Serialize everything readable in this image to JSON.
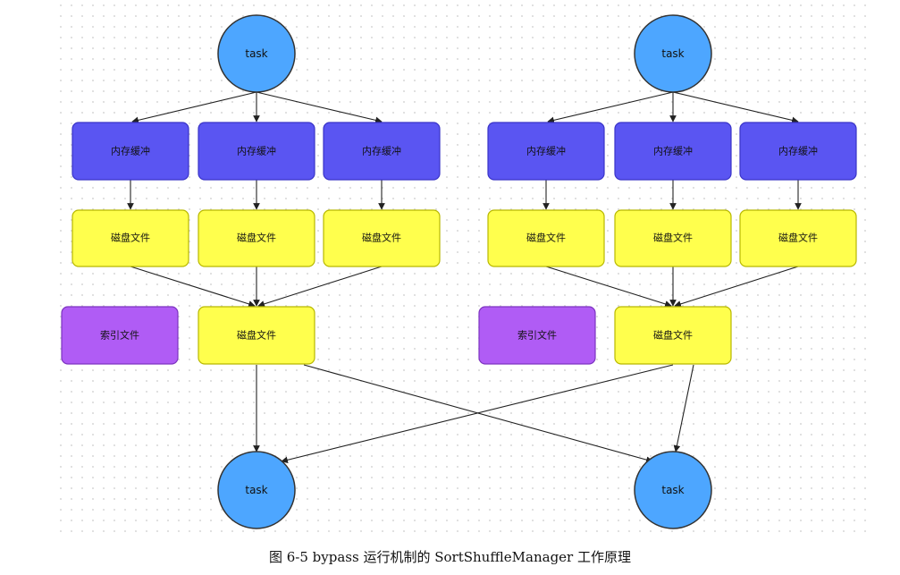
{
  "labels": {
    "task": "task",
    "memory_buffer": "内存缓冲",
    "disk_file": "磁盘文件",
    "index_file": "索引文件"
  },
  "caption": "图 6-5 bypass 运行机制的 SortShuffleManager 工作原理",
  "colors": {
    "task": "#4da6ff",
    "memory_buffer": "#5a55f2",
    "disk_file": "#ffff4d",
    "index_file": "#b05cf5",
    "stroke": "#333333"
  }
}
